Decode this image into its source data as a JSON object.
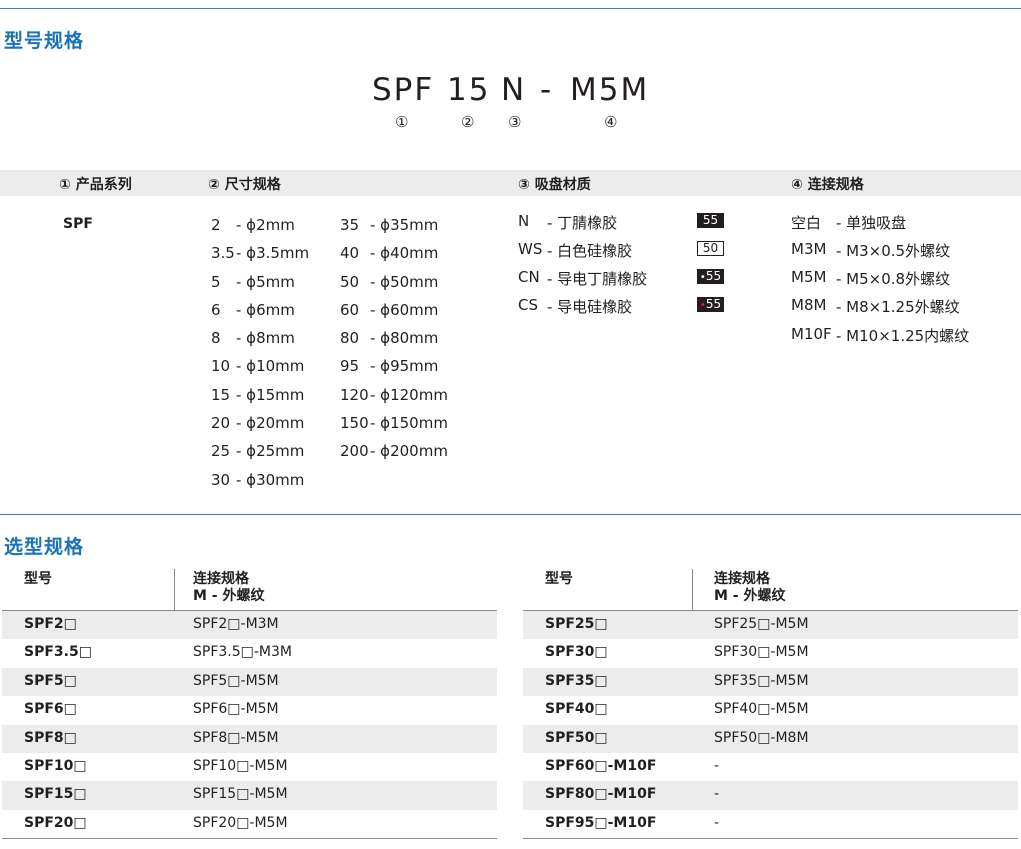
{
  "sections": {
    "model_spec_title": "型号规格",
    "selection_title": "选型规格"
  },
  "model_code": {
    "series": "SPF",
    "size": "15",
    "material": "N",
    "dash": "-",
    "connection": "M5M",
    "markers": [
      "①",
      "②",
      "③",
      "④"
    ]
  },
  "spec_headers": {
    "series": "① 产品系列",
    "size": "② 尺寸规格",
    "material": "③ 吸盘材质",
    "connection": "④ 连接规格"
  },
  "series_value": "SPF",
  "sizes_col1": [
    {
      "code": "2",
      "desc": "- ϕ2mm"
    },
    {
      "code": "3.5",
      "desc": "- ϕ3.5mm"
    },
    {
      "code": "5",
      "desc": "- ϕ5mm"
    },
    {
      "code": "6",
      "desc": "- ϕ6mm"
    },
    {
      "code": "8",
      "desc": "- ϕ8mm"
    },
    {
      "code": "10",
      "desc": "- ϕ10mm"
    },
    {
      "code": "15",
      "desc": "- ϕ15mm"
    },
    {
      "code": "20",
      "desc": "- ϕ20mm"
    },
    {
      "code": "25",
      "desc": "- ϕ25mm"
    },
    {
      "code": "30",
      "desc": "- ϕ30mm"
    }
  ],
  "sizes_col2": [
    {
      "code": "35",
      "desc": "- ϕ35mm"
    },
    {
      "code": "40",
      "desc": "- ϕ40mm"
    },
    {
      "code": "50",
      "desc": "- ϕ50mm"
    },
    {
      "code": "60",
      "desc": "- ϕ60mm"
    },
    {
      "code": "80",
      "desc": "- ϕ80mm"
    },
    {
      "code": "95",
      "desc": "- ϕ95mm"
    },
    {
      "code": "120",
      "desc": "- ϕ120mm"
    },
    {
      "code": "150",
      "desc": "- ϕ150mm"
    },
    {
      "code": "200",
      "desc": "- ϕ200mm"
    }
  ],
  "materials": [
    {
      "code": "N",
      "desc": "- 丁腈橡胶",
      "hardness": "55",
      "style": "dark"
    },
    {
      "code": "WS",
      "desc": "- 白色硅橡胶",
      "hardness": "50",
      "style": "outline"
    },
    {
      "code": "CN",
      "desc": "- 导电丁腈橡胶",
      "hardness": "55",
      "style": "white-dot"
    },
    {
      "code": "CS",
      "desc": "- 导电硅橡胶",
      "hardness": "55",
      "style": "red-dot"
    }
  ],
  "connections": [
    {
      "code": "空白",
      "desc": "- 单独吸盘"
    },
    {
      "code": "M3M",
      "desc": "- M3×0.5外螺纹"
    },
    {
      "code": "M5M",
      "desc": "- M5×0.8外螺纹"
    },
    {
      "code": "M8M",
      "desc": "- M8×1.25外螺纹"
    },
    {
      "code": "M10F",
      "desc": "- M10×1.25内螺纹"
    }
  ],
  "selection_table": {
    "header_model": "型号",
    "header_conn_line1": "连接规格",
    "header_conn_line2": "M - 外螺纹",
    "left_rows": [
      {
        "model": "SPF2□",
        "conn": "SPF2□-M3M"
      },
      {
        "model": "SPF3.5□",
        "conn": "SPF3.5□-M3M"
      },
      {
        "model": "SPF5□",
        "conn": "SPF5□-M5M"
      },
      {
        "model": "SPF6□",
        "conn": "SPF6□-M5M"
      },
      {
        "model": "SPF8□",
        "conn": "SPF8□-M5M"
      },
      {
        "model": "SPF10□",
        "conn": "SPF10□-M5M"
      },
      {
        "model": "SPF15□",
        "conn": "SPF15□-M5M"
      },
      {
        "model": "SPF20□",
        "conn": "SPF20□-M5M"
      }
    ],
    "right_rows": [
      {
        "model": "SPF25□",
        "conn": "SPF25□-M5M"
      },
      {
        "model": "SPF30□",
        "conn": "SPF30□-M5M"
      },
      {
        "model": "SPF35□",
        "conn": "SPF35□-M5M"
      },
      {
        "model": "SPF40□",
        "conn": "SPF40□-M5M"
      },
      {
        "model": "SPF50□",
        "conn": "SPF50□-M8M"
      },
      {
        "model": "SPF60□-M10F",
        "conn": "-"
      },
      {
        "model": "SPF80□-M10F",
        "conn": "-"
      },
      {
        "model": "SPF95□-M10F",
        "conn": "-"
      }
    ]
  },
  "colors": {
    "accent": "#1a73b8",
    "rule": "#2f7fb8",
    "row_shade": "#ececec",
    "text": "#231f20",
    "red_dot": "#e0202a"
  }
}
